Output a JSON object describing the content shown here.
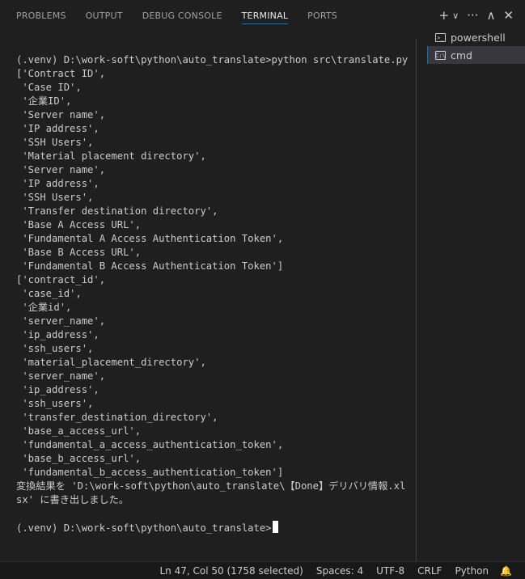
{
  "panel": {
    "tabs": [
      {
        "label": "PROBLEMS"
      },
      {
        "label": "OUTPUT"
      },
      {
        "label": "DEBUG CONSOLE"
      },
      {
        "label": "TERMINAL",
        "active": true
      },
      {
        "label": "PORTS"
      }
    ],
    "actions": {
      "new_terminal": "+",
      "dropdown": "∨",
      "more": "···",
      "maximize": "∧",
      "close": "✕"
    }
  },
  "sessions": [
    {
      "label": "powershell",
      "icon": "powershell-icon",
      "glyph": ">_"
    },
    {
      "label": "cmd",
      "icon": "cmd-icon",
      "glyph": "C:\\",
      "active": true
    }
  ],
  "terminal": {
    "lines": [
      "(.venv) D:\\work-soft\\python\\auto_translate>python src\\translate.py",
      "['Contract ID',",
      " 'Case ID',",
      " '企業ID',",
      " 'Server name',",
      " 'IP address',",
      " 'SSH Users',",
      " 'Material placement directory',",
      " 'Server name',",
      " 'IP address',",
      " 'SSH Users',",
      " 'Transfer destination directory',",
      " 'Base A Access URL',",
      " 'Fundamental A Access Authentication Token',",
      " 'Base B Access URL',",
      " 'Fundamental B Access Authentication Token']",
      "['contract_id',",
      " 'case_id',",
      " '企業id',",
      " 'server_name',",
      " 'ip_address',",
      " 'ssh_users',",
      " 'material_placement_directory',",
      " 'server_name',",
      " 'ip_address',",
      " 'ssh_users',",
      " 'transfer_destination_directory',",
      " 'base_a_access_url',",
      " 'fundamental_a_access_authentication_token',",
      " 'base_b_access_url',",
      " 'fundamental_b_access_authentication_token']",
      "変換結果を 'D:\\work-soft\\python\\auto_translate\\【Done】デリバリ情報.xl",
      "sx' に書き出しました。",
      "",
      "(.venv) D:\\work-soft\\python\\auto_translate>"
    ]
  },
  "statusbar": {
    "position": "Ln 47, Col 50 (1758 selected)",
    "spaces": "Spaces: 4",
    "encoding": "UTF-8",
    "eol": "CRLF",
    "language": "Python",
    "bell": "🔔"
  },
  "colors": {
    "background": "#1f1f1f",
    "accent": "#0078d4",
    "text": "#cccccc"
  }
}
